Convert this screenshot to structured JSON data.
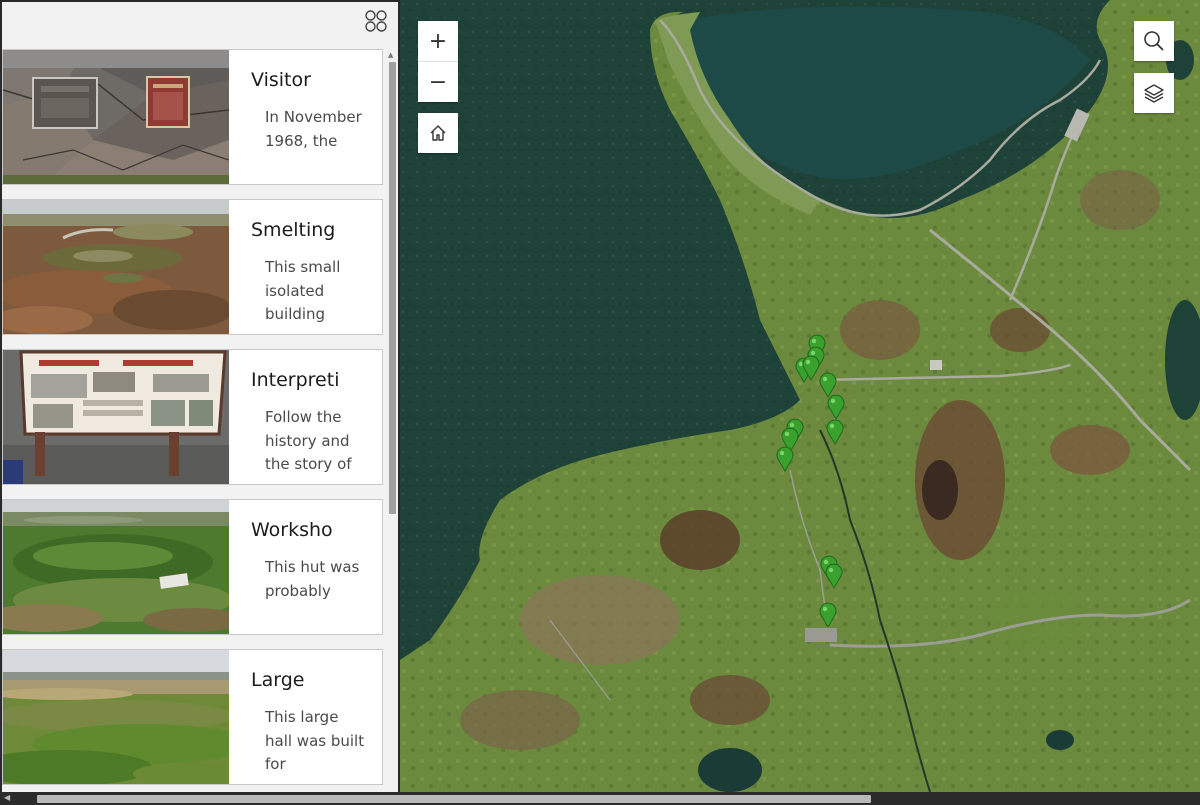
{
  "sidebar": {
    "grid_toggle_icon": "grid-icon",
    "cards": [
      {
        "title": "Visitor",
        "desc": "In November 1968, the",
        "thumb": "plaques-on-rock"
      },
      {
        "title": "Smelting",
        "desc": "This small isolated building",
        "thumb": "grassland-mounds"
      },
      {
        "title": "Interpreti",
        "desc": "Follow the history and the story of",
        "thumb": "interpretive-sign"
      },
      {
        "title": "Worksho",
        "desc": "This hut was probably",
        "thumb": "green-hollow-with-sign"
      },
      {
        "title": "Large",
        "desc": "This large hall was built for",
        "thumb": "grassy-coastline"
      }
    ]
  },
  "map": {
    "controls": {
      "zoom_in_label": "+",
      "zoom_out_label": "−",
      "home_icon": "home-icon",
      "search_icon": "search-icon",
      "layers_icon": "layers-icon"
    },
    "marker_color": "#3aa02e",
    "marker_count": 15
  },
  "colors": {
    "ocean": "#1e4038",
    "land": "#6d8a40",
    "sidebar_bg": "#f2f2f2"
  }
}
